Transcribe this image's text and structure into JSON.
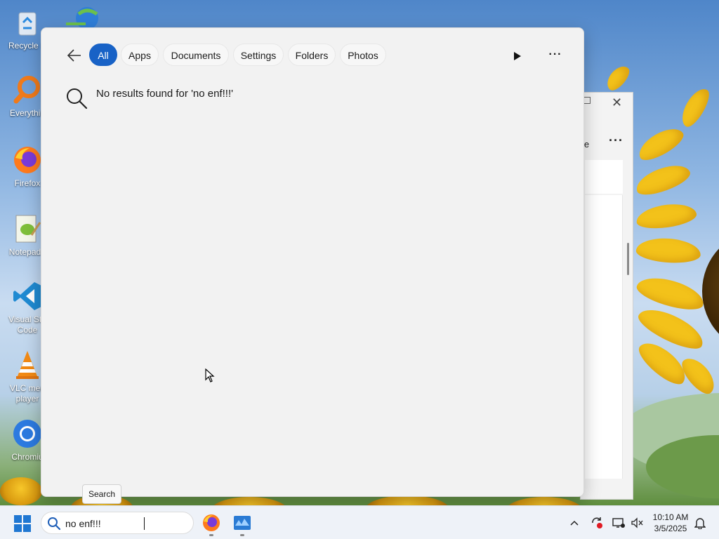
{
  "desktop": {
    "icons": [
      {
        "label": "Recycle B",
        "icon": "recycle-bin-icon"
      },
      {
        "label": "Everythin",
        "icon": "everything-search-icon"
      },
      {
        "label": "Firefox",
        "icon": "firefox-icon"
      },
      {
        "label": "Notepad+",
        "icon": "notepad-plus-plus-icon"
      },
      {
        "label": "Visual Stu Code",
        "label_line1": "Visual Stu",
        "label_line2": "Code",
        "icon": "vscode-icon"
      },
      {
        "label": "VLC med player",
        "label_line1": "VLC med",
        "label_line2": "player",
        "icon": "vlc-icon"
      },
      {
        "label": "Chromiu",
        "icon": "chromium-icon"
      }
    ],
    "top_icon": "internet-download-manager-icon"
  },
  "background_window": {
    "label": "le",
    "more": "···"
  },
  "search_panel": {
    "tabs": [
      {
        "label": "All",
        "active": true
      },
      {
        "label": "Apps",
        "active": false
      },
      {
        "label": "Documents",
        "active": false
      },
      {
        "label": "Settings",
        "active": false
      },
      {
        "label": "Folders",
        "active": false
      },
      {
        "label": "Photos",
        "active": false
      }
    ],
    "more_label": "···",
    "no_results_text": "No results found for 'no enf!!!'"
  },
  "tooltip": {
    "text": "Search"
  },
  "taskbar": {
    "search_value": "no enf!!!",
    "apps": [
      "firefox-icon",
      "task-manager-icon"
    ],
    "tray": [
      "chevron-up-icon",
      "sync-icon",
      "network-icon",
      "volume-muted-icon"
    ],
    "clock_time": "10:10 AM",
    "clock_date": "3/5/2025",
    "notification_icon": "bell-icon"
  },
  "colors": {
    "accent": "#1862c6",
    "panel_bg": "#f2f2f2",
    "taskbar_bg": "#eef2f8"
  }
}
